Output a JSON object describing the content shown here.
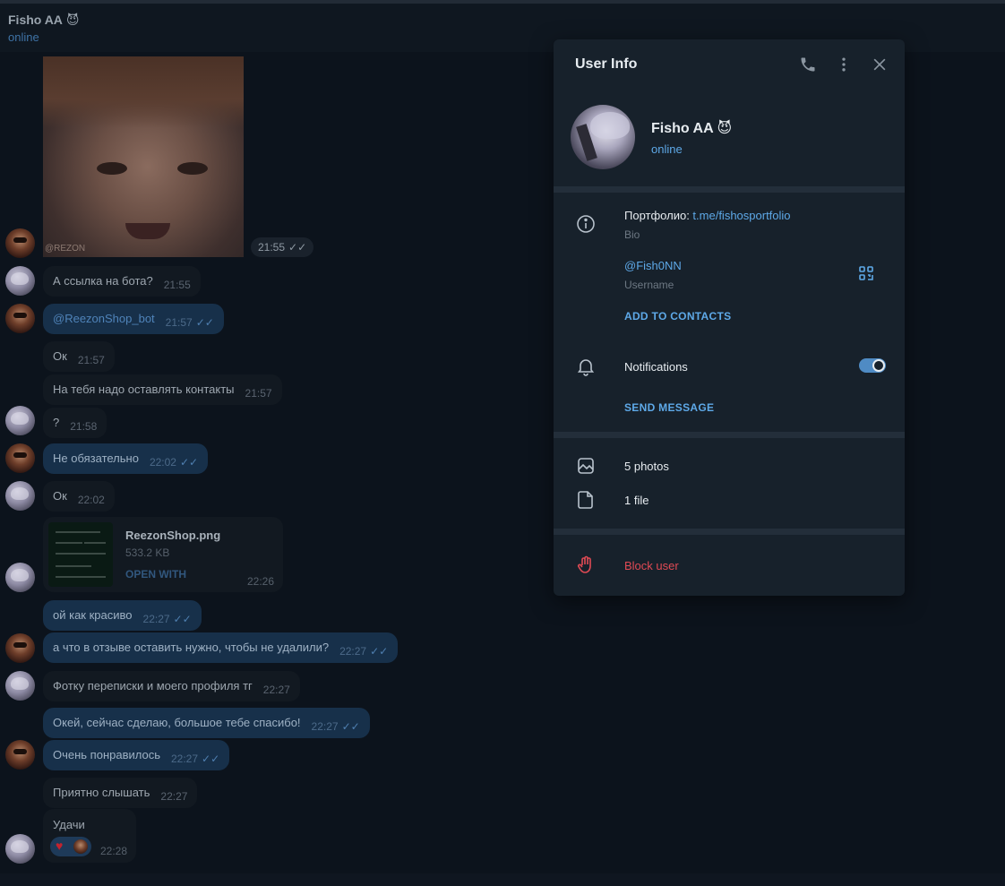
{
  "header": {
    "name": "Fisho AA",
    "emoji": "😈",
    "status": "online"
  },
  "photo_message": {
    "watermark": "@REZON",
    "time": "21:55",
    "ticks": "✓✓"
  },
  "messages": [
    {
      "text": "А ссылка на бота?",
      "time": "21:55"
    },
    {
      "text": "@ReezonShop_bot",
      "time": "21:57",
      "ticks": "✓✓"
    },
    {
      "text": "Ок",
      "time": "21:57"
    },
    {
      "text": "На тебя надо оставлять контакты",
      "time": "21:57"
    },
    {
      "text": "?",
      "time": "21:58"
    },
    {
      "text": "Не обязательно",
      "time": "22:02",
      "ticks": "✓✓"
    },
    {
      "text": "Ок",
      "time": "22:02"
    },
    {
      "text": "ой как красиво",
      "time": "22:27",
      "ticks": "✓✓"
    },
    {
      "text": "а что в отзыве оставить нужно, чтобы не удалили?",
      "time": "22:27",
      "ticks": "✓✓"
    },
    {
      "text": "Фотку переписки и моего профиля тг",
      "time": "22:27"
    },
    {
      "text": "Окей, сейчас сделаю, большое тебе спасибо!",
      "time": "22:27",
      "ticks": "✓✓"
    },
    {
      "text": "Очень понравилось",
      "time": "22:27",
      "ticks": "✓✓"
    },
    {
      "text": "Приятно слышать",
      "time": "22:27"
    }
  ],
  "file_message": {
    "name": "ReezonShop.png",
    "size": "533.2 KB",
    "open_label": "OPEN WITH",
    "time": "22:26"
  },
  "reaction_message": {
    "text": "Удачи",
    "reaction": "♥",
    "time": "22:28"
  },
  "panel": {
    "title": "User Info",
    "name": "Fisho AA",
    "emoji": "😈",
    "status": "online",
    "bio_prefix": "Портфолио: ",
    "bio_link": "t.me/fishosportfolio",
    "bio_label": "Bio",
    "username": "@Fish0NN",
    "username_label": "Username",
    "add_contacts": "ADD TO CONTACTS",
    "notifications": "Notifications",
    "notifications_on": true,
    "send_message": "SEND MESSAGE",
    "photos": "5 photos",
    "files": "1 file",
    "block": "Block user"
  },
  "colors": {
    "accent": "#5ea9e8",
    "danger": "#e04a54",
    "outgoing_bubble": "#17304a",
    "incoming_bubble": "#121921",
    "panel_bg": "#17212b"
  }
}
